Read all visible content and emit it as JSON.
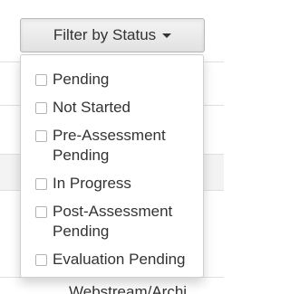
{
  "filter_button": {
    "label": "Filter by Status",
    "icon": "caret-down-icon"
  },
  "menu": {
    "items": [
      {
        "label": "Pending",
        "checked": false
      },
      {
        "label": "Not Started",
        "checked": false
      },
      {
        "label": "Pre-Assessment Pending",
        "checked": false
      },
      {
        "label": "In Progress",
        "checked": false
      },
      {
        "label": "Post-Assessment Pending",
        "checked": false
      },
      {
        "label": "Evaluation Pending",
        "checked": false
      }
    ]
  },
  "background": {
    "partial_text": "Webstream/Archi"
  }
}
